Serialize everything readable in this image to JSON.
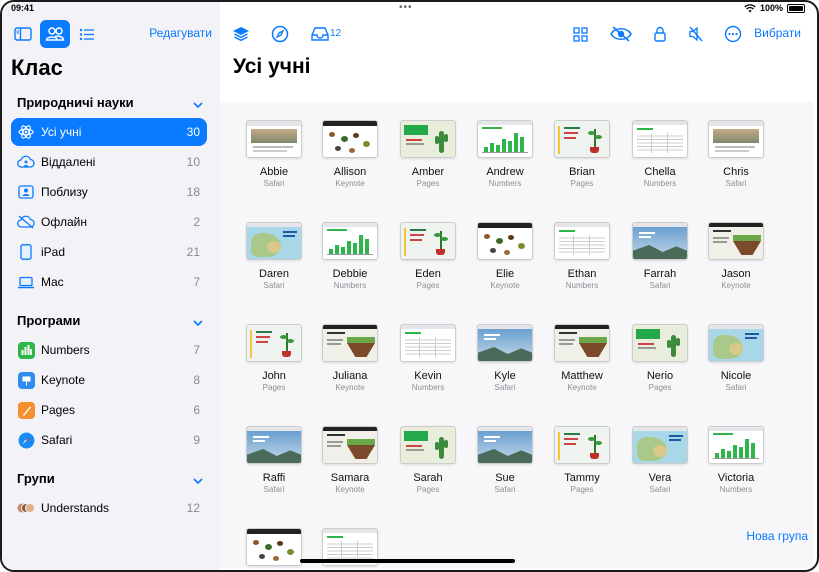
{
  "status": {
    "time": "09:41",
    "battery": "100%"
  },
  "sidebar": {
    "edit_label": "Редагувати",
    "title": "Клас",
    "sections": {
      "science": "Природничі науки",
      "apps": "Програми",
      "groups": "Групи"
    },
    "items": [
      {
        "label": "Усі учні",
        "count": "30"
      },
      {
        "label": "Віддалені",
        "count": "10"
      },
      {
        "label": "Поблизу",
        "count": "18"
      },
      {
        "label": "Офлайн",
        "count": "2"
      },
      {
        "label": "iPad",
        "count": "21"
      },
      {
        "label": "Mac",
        "count": "7"
      }
    ],
    "apps": [
      {
        "label": "Numbers",
        "count": "7"
      },
      {
        "label": "Keynote",
        "count": "8"
      },
      {
        "label": "Pages",
        "count": "6"
      },
      {
        "label": "Safari",
        "count": "9"
      }
    ],
    "groups": [
      {
        "label": "Understands",
        "count": "12"
      }
    ],
    "new_group_label": "Нова група"
  },
  "main": {
    "title": "Усі учні",
    "inbox_count": "12",
    "choose_label": "Вибрати",
    "students": [
      {
        "name": "Abbie",
        "app": "Safari",
        "thumb": "safari-web"
      },
      {
        "name": "Allison",
        "app": "Keynote",
        "thumb": "keynote-bugs"
      },
      {
        "name": "Amber",
        "app": "Pages",
        "thumb": "pages-cactus"
      },
      {
        "name": "Andrew",
        "app": "Numbers",
        "thumb": "numbers-chart"
      },
      {
        "name": "Brian",
        "app": "Pages",
        "thumb": "pages-plant"
      },
      {
        "name": "Chella",
        "app": "Numbers",
        "thumb": "numbers-table"
      },
      {
        "name": "Chris",
        "app": "Safari",
        "thumb": "safari-web"
      },
      {
        "name": "Daren",
        "app": "Safari",
        "thumb": "safari-map"
      },
      {
        "name": "Debbie",
        "app": "Numbers",
        "thumb": "numbers-chart"
      },
      {
        "name": "Eden",
        "app": "Pages",
        "thumb": "pages-plant"
      },
      {
        "name": "Elie",
        "app": "Keynote",
        "thumb": "keynote-bugs"
      },
      {
        "name": "Ethan",
        "app": "Numbers",
        "thumb": "numbers-table"
      },
      {
        "name": "Farrah",
        "app": "Safari",
        "thumb": "safari-landscape"
      },
      {
        "name": "Jason",
        "app": "Keynote",
        "thumb": "keynote-soil"
      },
      {
        "name": "John",
        "app": "Pages",
        "thumb": "pages-plant"
      },
      {
        "name": "Juliana",
        "app": "Keynote",
        "thumb": "keynote-soil"
      },
      {
        "name": "Kevin",
        "app": "Numbers",
        "thumb": "numbers-table"
      },
      {
        "name": "Kyle",
        "app": "Safari",
        "thumb": "safari-landscape"
      },
      {
        "name": "Matthew",
        "app": "Keynote",
        "thumb": "keynote-soil"
      },
      {
        "name": "Nerio",
        "app": "Pages",
        "thumb": "pages-cactus"
      },
      {
        "name": "Nicole",
        "app": "Safari",
        "thumb": "safari-map"
      },
      {
        "name": "Raffi",
        "app": "Safari",
        "thumb": "safari-landscape"
      },
      {
        "name": "Samara",
        "app": "Keynote",
        "thumb": "keynote-soil"
      },
      {
        "name": "Sarah",
        "app": "Pages",
        "thumb": "pages-cactus"
      },
      {
        "name": "Sue",
        "app": "Safari",
        "thumb": "safari-landscape"
      },
      {
        "name": "Tammy",
        "app": "Pages",
        "thumb": "pages-plant"
      },
      {
        "name": "Vera",
        "app": "Safari",
        "thumb": "safari-map"
      },
      {
        "name": "Victoria",
        "app": "Numbers",
        "thumb": "numbers-chart"
      },
      {
        "name": "",
        "app": "",
        "thumb": "keynote-bugs"
      },
      {
        "name": "",
        "app": "",
        "thumb": "numbers-table"
      }
    ]
  },
  "colors": {
    "accent": "#0a7aff",
    "sidebar_bg": "#f2f2f7",
    "numbers": "#2fb64a",
    "keynote": "#2f8cf0",
    "pages": "#f6902f",
    "safari": "#1a8cf5"
  }
}
